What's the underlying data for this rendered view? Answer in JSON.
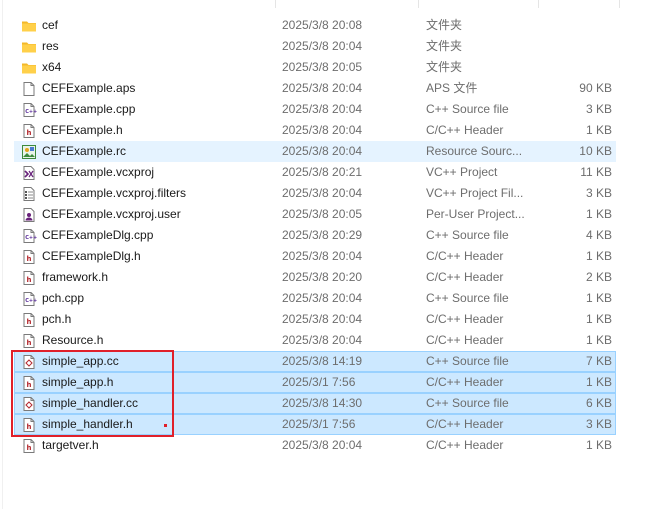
{
  "files": [
    {
      "name": "cef",
      "date": "2025/3/8 20:08",
      "type": "文件夹",
      "size": "",
      "icon": "folder-icon",
      "state": ""
    },
    {
      "name": "res",
      "date": "2025/3/8 20:04",
      "type": "文件夹",
      "size": "",
      "icon": "folder-icon",
      "state": ""
    },
    {
      "name": "x64",
      "date": "2025/3/8 20:05",
      "type": "文件夹",
      "size": "",
      "icon": "folder-icon",
      "state": ""
    },
    {
      "name": "CEFExample.aps",
      "date": "2025/3/8 20:04",
      "type": "APS 文件",
      "size": "90 KB",
      "icon": "generic-file-icon",
      "state": ""
    },
    {
      "name": "CEFExample.cpp",
      "date": "2025/3/8 20:04",
      "type": "C++ Source file",
      "size": "3 KB",
      "icon": "cpp-file-icon",
      "state": ""
    },
    {
      "name": "CEFExample.h",
      "date": "2025/3/8 20:04",
      "type": "C/C++ Header",
      "size": "1 KB",
      "icon": "header-file-icon",
      "state": ""
    },
    {
      "name": "CEFExample.rc",
      "date": "2025/3/8 20:04",
      "type": "Resource Sourc...",
      "size": "10 KB",
      "icon": "resource-file-icon",
      "state": "hov"
    },
    {
      "name": "CEFExample.vcxproj",
      "date": "2025/3/8 20:21",
      "type": "VC++ Project",
      "size": "11 KB",
      "icon": "vcxproj-file-icon",
      "state": ""
    },
    {
      "name": "CEFExample.vcxproj.filters",
      "date": "2025/3/8 20:04",
      "type": "VC++ Project Fil...",
      "size": "3 KB",
      "icon": "filters-file-icon",
      "state": ""
    },
    {
      "name": "CEFExample.vcxproj.user",
      "date": "2025/3/8 20:05",
      "type": "Per-User Project...",
      "size": "1 KB",
      "icon": "user-file-icon",
      "state": ""
    },
    {
      "name": "CEFExampleDlg.cpp",
      "date": "2025/3/8 20:29",
      "type": "C++ Source file",
      "size": "4 KB",
      "icon": "cpp-file-icon",
      "state": ""
    },
    {
      "name": "CEFExampleDlg.h",
      "date": "2025/3/8 20:04",
      "type": "C/C++ Header",
      "size": "1 KB",
      "icon": "header-file-icon",
      "state": ""
    },
    {
      "name": "framework.h",
      "date": "2025/3/8 20:20",
      "type": "C/C++ Header",
      "size": "2 KB",
      "icon": "header-file-icon",
      "state": ""
    },
    {
      "name": "pch.cpp",
      "date": "2025/3/8 20:04",
      "type": "C++ Source file",
      "size": "1 KB",
      "icon": "cpp-file-icon",
      "state": ""
    },
    {
      "name": "pch.h",
      "date": "2025/3/8 20:04",
      "type": "C/C++ Header",
      "size": "1 KB",
      "icon": "header-file-icon",
      "state": ""
    },
    {
      "name": "Resource.h",
      "date": "2025/3/8 20:04",
      "type": "C/C++ Header",
      "size": "1 KB",
      "icon": "header-file-icon",
      "state": ""
    },
    {
      "name": "simple_app.cc",
      "date": "2025/3/8 14:19",
      "type": "C++ Source file",
      "size": "7 KB",
      "icon": "cc-file-icon",
      "state": "sel"
    },
    {
      "name": "simple_app.h",
      "date": "2025/3/1 7:56",
      "type": "C/C++ Header",
      "size": "1 KB",
      "icon": "header-file-icon",
      "state": "sel"
    },
    {
      "name": "simple_handler.cc",
      "date": "2025/3/8 14:30",
      "type": "C++ Source file",
      "size": "6 KB",
      "icon": "cc-file-icon",
      "state": "sel"
    },
    {
      "name": "simple_handler.h",
      "date": "2025/3/1 7:56",
      "type": "C/C++ Header",
      "size": "3 KB",
      "icon": "header-file-icon",
      "state": "sel"
    },
    {
      "name": "targetver.h",
      "date": "2025/3/8 20:04",
      "type": "C/C++ Header",
      "size": "1 KB",
      "icon": "header-file-icon",
      "state": ""
    }
  ],
  "colors": {
    "selection_bg": "#cce8ff",
    "selection_border": "#99d1ff",
    "hover_bg": "#e5f3ff",
    "annotation_red": "#e0202a",
    "folder_yellow": "#ffd04a"
  }
}
